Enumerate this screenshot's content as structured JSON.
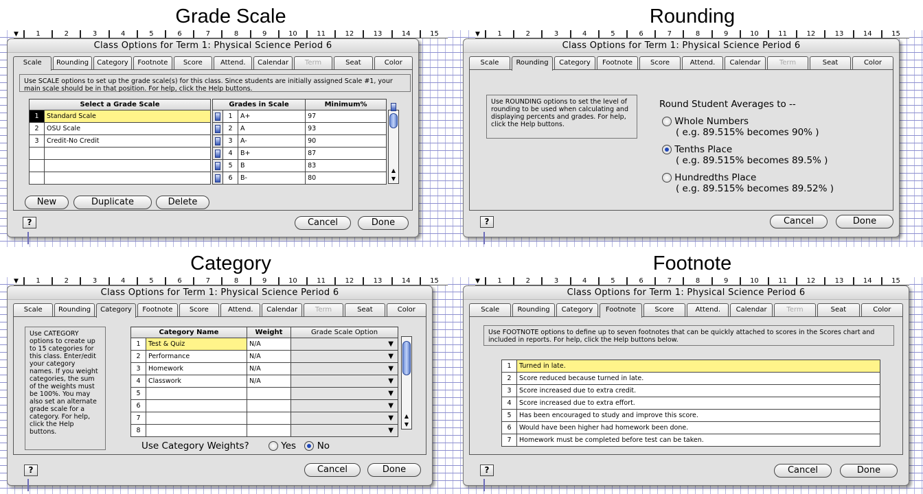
{
  "dialog_title": "Class Options for Term 1: Physical Science Period 6",
  "ruler_numbers": [
    "1",
    "2",
    "3",
    "4",
    "5",
    "6",
    "7",
    "8",
    "9",
    "10",
    "11",
    "12",
    "13",
    "14",
    "15"
  ],
  "tabs": [
    "Scale",
    "Rounding",
    "Category",
    "Footnote",
    "Score",
    "Attend.",
    "Calendar",
    "Term",
    "Seat",
    "Color"
  ],
  "buttons": {
    "cancel": "Cancel",
    "done": "Done",
    "help": "?"
  },
  "scale": {
    "heading": "Grade Scale",
    "info": "Use SCALE options to set up the grade scale(s) for this class. Since students are initially assigned Scale #1, your main scale should be in that position. For help, click the Help buttons.",
    "left_header": "Select a Grade Scale",
    "scales": [
      {
        "n": "1",
        "name": "Standard Scale"
      },
      {
        "n": "2",
        "name": "OSU Scale"
      },
      {
        "n": "3",
        "name": "Credit-No Credit"
      },
      {
        "n": "",
        "name": ""
      },
      {
        "n": "",
        "name": ""
      },
      {
        "n": "",
        "name": ""
      }
    ],
    "grades_header": "Grades in Scale",
    "min_header": "Minimum%",
    "grades": [
      {
        "n": "1",
        "g": "A+",
        "m": "97"
      },
      {
        "n": "2",
        "g": "A",
        "m": "93"
      },
      {
        "n": "3",
        "g": "A-",
        "m": "90"
      },
      {
        "n": "4",
        "g": "B+",
        "m": "87"
      },
      {
        "n": "5",
        "g": "B",
        "m": "83"
      },
      {
        "n": "6",
        "g": "B-",
        "m": "80"
      }
    ],
    "new": "New",
    "duplicate": "Duplicate",
    "delete": "Delete"
  },
  "rounding": {
    "heading": "Rounding",
    "info": "Use ROUNDING options to set the level of rounding to be used when calculating and displaying percents and grades. For help, click the Help buttons.",
    "prompt": "Round Student Averages to --",
    "options": [
      {
        "label": "Whole Numbers",
        "example": "( e.g. 89.515% becomes 90% )",
        "selected": false
      },
      {
        "label": "Tenths Place",
        "example": "( e.g. 89.515% becomes 89.5% )",
        "selected": true
      },
      {
        "label": "Hundredths Place",
        "example": "( e.g. 89.515% becomes 89.52% )",
        "selected": false
      }
    ]
  },
  "category": {
    "heading": "Category",
    "info": "Use CATEGORY options to create up to 15 categories for this class. Enter/edit your category names. If you weight categories, the sum of the weights must be 100%. You may also set an alternate grade scale for a category. For help, click the Help buttons.",
    "col_name": "Category Name",
    "col_weight": "Weight",
    "col_scale": "Grade Scale Option",
    "rows": [
      {
        "n": "1",
        "name": "Test & Quiz",
        "weight": "N/A"
      },
      {
        "n": "2",
        "name": "Performance",
        "weight": "N/A"
      },
      {
        "n": "3",
        "name": "Homework",
        "weight": "N/A"
      },
      {
        "n": "4",
        "name": "Classwork",
        "weight": "N/A"
      },
      {
        "n": "5",
        "name": "",
        "weight": ""
      },
      {
        "n": "6",
        "name": "",
        "weight": ""
      },
      {
        "n": "7",
        "name": "",
        "weight": ""
      },
      {
        "n": "8",
        "name": "",
        "weight": ""
      }
    ],
    "weights_prompt": "Use Category Weights?",
    "yes": "Yes",
    "no": "No"
  },
  "footnote": {
    "heading": "Footnote",
    "info": "Use FOOTNOTE options to define up to seven footnotes that can be quickly attached to scores in the Scores chart and included in reports. For help, click the Help buttons below.",
    "rows": [
      {
        "n": "1",
        "text": "Turned in late."
      },
      {
        "n": "2",
        "text": "Score reduced because turned in late."
      },
      {
        "n": "3",
        "text": "Score increased due to extra credit."
      },
      {
        "n": "4",
        "text": "Score increased due to extra effort."
      },
      {
        "n": "5",
        "text": "Has been encouraged to study and improve this score."
      },
      {
        "n": "6",
        "text": "Would have been higher had homework been done."
      },
      {
        "n": "7",
        "text": "Homework must be completed before test can be taken."
      }
    ]
  },
  "colors": {
    "selection": "#fff48a",
    "accent": "#1f47b8",
    "grid": "#8d8fd0"
  }
}
